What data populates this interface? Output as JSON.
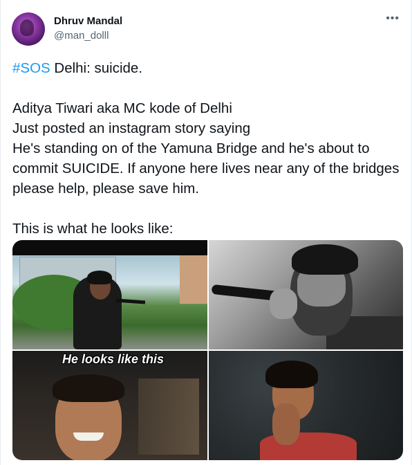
{
  "author": {
    "name": "Dhruv Mandal",
    "handle": "@man_dolll"
  },
  "menu": {
    "more_label": "•••",
    "icon": "more-horizontal-icon"
  },
  "tweet": {
    "hashtag": "#SOS",
    "line1_rest": " Delhi: suicide.",
    "line2": "Aditya Tiwari aka MC kode of Delhi",
    "line3": "Just posted an instagram story saying",
    "line4": "He's standing on of the Yamuna Bridge and he's about to commit SUICIDE. If anyone here lives near any of the bridges please help, please save him.",
    "line5": "This is what he looks like:"
  },
  "media": {
    "caption_overlay": "He looks like this"
  },
  "colors": {
    "hashtag": "#1d9bf0",
    "text": "#0f1419",
    "secondary": "#536471"
  }
}
